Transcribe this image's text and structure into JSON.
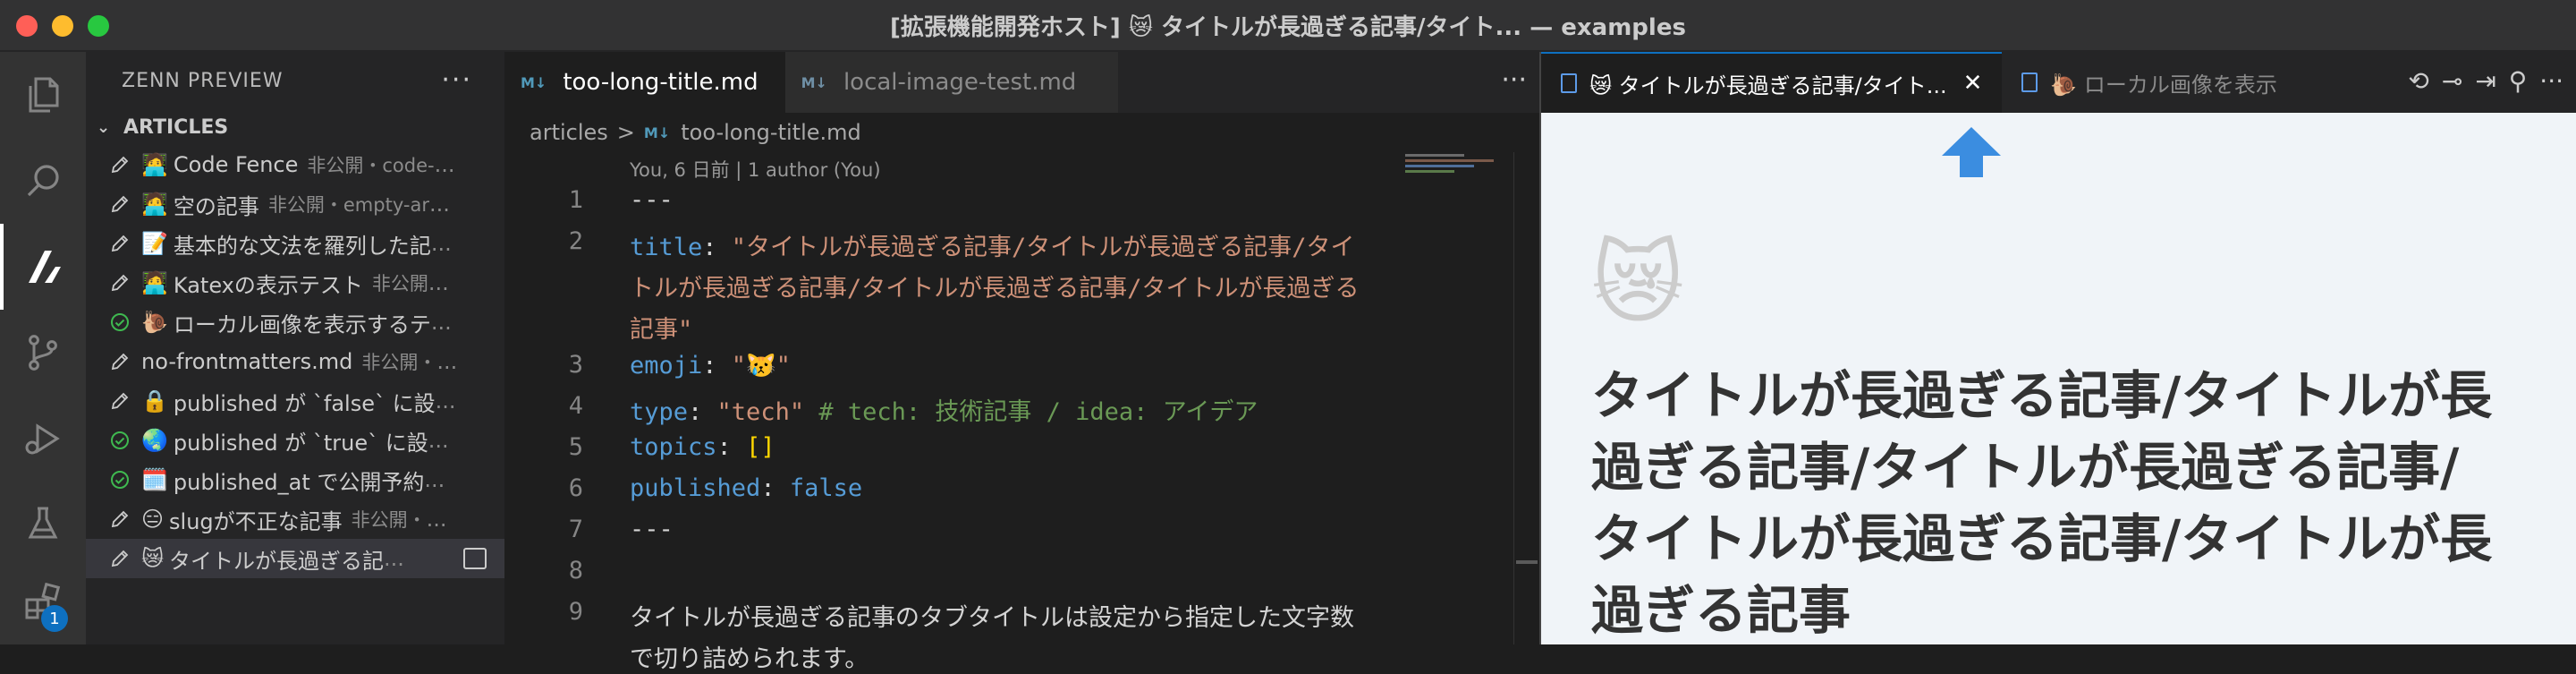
{
  "window": {
    "title": "[拡張機能開発ホスト] 😿 タイトルが長過ぎる記事/タイト... — examples"
  },
  "activity_bar": {
    "icons": [
      "explorer-icon",
      "search-icon",
      "zenn-icon",
      "source-control-icon",
      "run-debug-icon",
      "testing-icon",
      "extensions-icon"
    ],
    "extensions_badge": "1"
  },
  "sidebar": {
    "title": "ZENN PREVIEW",
    "more": "···",
    "section": "ARTICLES",
    "items": [
      {
        "icon": "pencil",
        "emoji": "🧑‍💻",
        "name": "Code Fence",
        "desc": "非公開・code-",
        "ellip": "..."
      },
      {
        "icon": "pencil",
        "emoji": "🧑‍💻",
        "name": "空の記事",
        "desc": "非公開・empty-ar",
        "ellip": "..."
      },
      {
        "icon": "pencil",
        "emoji": "📝",
        "name": "基本的な文法を羅列した記",
        "desc": "",
        "ellip": "..."
      },
      {
        "icon": "pencil",
        "emoji": "🧑‍💻",
        "name": "Katexの表示テスト",
        "desc": "非公開",
        "ellip": "..."
      },
      {
        "icon": "check",
        "emoji": "🐌",
        "name": "ローカル画像を表示するテ",
        "desc": "",
        "ellip": "..."
      },
      {
        "icon": "pencil",
        "emoji": "",
        "name": "no-frontmatters.md",
        "desc": "非公開・",
        "ellip": "..."
      },
      {
        "icon": "pencil",
        "emoji": "🔒",
        "name": "published が `false` に設",
        "desc": "",
        "ellip": "..."
      },
      {
        "icon": "check",
        "emoji": "🌏",
        "name": "published が `true` に設",
        "desc": "",
        "ellip": "..."
      },
      {
        "icon": "check",
        "emoji": "🗓️",
        "name": "published_at で公開予約",
        "desc": "",
        "ellip": "..."
      },
      {
        "icon": "pencil",
        "emoji": "😑",
        "name": "slugが不正な記事",
        "desc": "非公開・",
        "ellip": "..."
      },
      {
        "icon": "pencil",
        "emoji": "😿",
        "name": "タイトルが長過ぎる記",
        "desc": "",
        "ellip": "..."
      }
    ]
  },
  "editor": {
    "tabs": [
      {
        "label": "too-long-title.md",
        "active": true
      },
      {
        "label": "local-image-test.md",
        "active": false
      }
    ],
    "more": "···",
    "breadcrumb": {
      "folder": "articles",
      "sep": ">",
      "file": "too-long-title.md"
    },
    "md_icon": "M↓",
    "codelens": "You, 6 日前 | 1 author (You)",
    "lines": [
      {
        "n": "1",
        "parts": [
          {
            "t": "---",
            "c": "p"
          }
        ]
      },
      {
        "n": "2",
        "parts": [
          {
            "t": "title",
            "c": "k"
          },
          {
            "t": ": ",
            "c": "p"
          },
          {
            "t": "\"タイトルが長過ぎる記事/タイトルが長過ぎる記事/タイ",
            "c": "s"
          }
        ]
      },
      {
        "n": "",
        "parts": [
          {
            "t": "トルが長過ぎる記事/タイトルが長過ぎる記事/タイトルが長過ぎる",
            "c": "s"
          }
        ]
      },
      {
        "n": "",
        "parts": [
          {
            "t": "記事\"",
            "c": "s"
          }
        ]
      },
      {
        "n": "3",
        "parts": [
          {
            "t": "emoji",
            "c": "k"
          },
          {
            "t": ": ",
            "c": "p"
          },
          {
            "t": "\"😿\"",
            "c": "s"
          }
        ]
      },
      {
        "n": "4",
        "parts": [
          {
            "t": "type",
            "c": "k"
          },
          {
            "t": ": ",
            "c": "p"
          },
          {
            "t": "\"tech\"",
            "c": "s"
          },
          {
            "t": " # tech: 技術記事 / idea: アイデア",
            "c": "c"
          }
        ]
      },
      {
        "n": "5",
        "parts": [
          {
            "t": "topics",
            "c": "k"
          },
          {
            "t": ": ",
            "c": "p"
          },
          {
            "t": "[]",
            "c": "y"
          }
        ]
      },
      {
        "n": "6",
        "parts": [
          {
            "t": "published",
            "c": "k"
          },
          {
            "t": ": ",
            "c": "p"
          },
          {
            "t": "false",
            "c": "k"
          }
        ]
      },
      {
        "n": "7",
        "parts": [
          {
            "t": "---",
            "c": "p"
          }
        ]
      },
      {
        "n": "8",
        "parts": [
          {
            "t": "",
            "c": "p"
          }
        ]
      },
      {
        "n": "9",
        "parts": [
          {
            "t": "タイトルが長過ぎる記事のタブタイトルは設定から指定した文字数",
            "c": "p"
          }
        ]
      },
      {
        "n": "",
        "parts": [
          {
            "t": "で切り詰められます。",
            "c": "p"
          }
        ]
      }
    ]
  },
  "preview": {
    "tabs": [
      {
        "label": "😿 タイトルが長過ぎる記事/タイト...",
        "active": true,
        "close": "✕"
      },
      {
        "label": "🐌 ローカル画像を表示",
        "active": false
      }
    ],
    "actions": [
      "⟲",
      "⊸",
      "⇥",
      "⚲",
      "···"
    ],
    "emoji": "😿",
    "title": "タイトルが長過ぎる記事/タイトルが長過ぎる記事/タイトルが長過ぎる記事/タイトルが長過ぎる記事/タイトルが長過ぎる記事"
  },
  "colors": {
    "keyword": "#569cd6",
    "string": "#ce9178",
    "comment": "#6a9955",
    "check": "#3fb950",
    "accent": "#0e70c0",
    "preview_arrow": "#3b8de0"
  }
}
